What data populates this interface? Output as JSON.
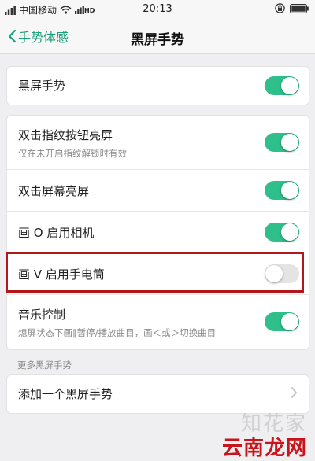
{
  "status_bar": {
    "carrier": "中国移动",
    "hd": "HD",
    "time": "20:13"
  },
  "nav": {
    "back_label": "手势体感",
    "title": "黑屏手势"
  },
  "rows": {
    "main_toggle": {
      "label": "黑屏手势",
      "on": true
    },
    "double_tap_fingerprint": {
      "label": "双击指纹按钮亮屏",
      "sub": "仅在未开启指纹解锁时有效",
      "on": true
    },
    "double_tap_screen": {
      "label": "双击屏幕亮屏",
      "on": true
    },
    "draw_o_camera": {
      "label": "画 O 启用相机",
      "on": true
    },
    "draw_v_flashlight": {
      "label": "画 V 启用手电筒",
      "on": false
    },
    "music_control": {
      "label": "音乐控制",
      "sub": "熄屏状态下画‖暂停/播放曲目，画＜或＞切换曲目",
      "on": true
    }
  },
  "more_section": {
    "header": "更多黑屏手势",
    "add_label": "添加一个黑屏手势"
  },
  "watermark": {
    "top": "知花家",
    "bottom": "云南龙网"
  },
  "colors": {
    "accent": "#2fbf8a",
    "nav_accent": "#1a9f7a",
    "highlight": "#b3171b"
  }
}
